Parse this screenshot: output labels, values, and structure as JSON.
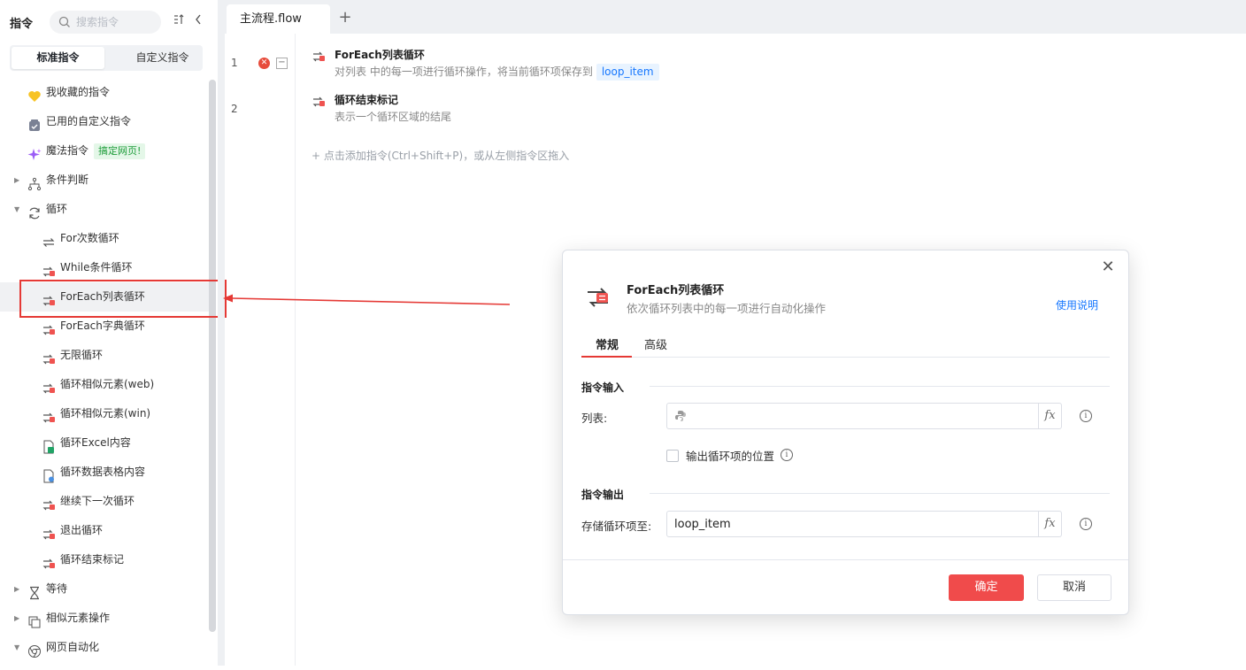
{
  "sidebar": {
    "title": "指令",
    "search_placeholder": "搜索指令",
    "tabs": [
      "标准指令",
      "自定义指令"
    ],
    "items": [
      {
        "label": "我收藏的指令",
        "icon": "heart-icon"
      },
      {
        "label": "已用的自定义指令",
        "icon": "custom-command-icon"
      },
      {
        "label": "魔法指令",
        "icon": "sparkle-icon",
        "badge": "搞定网页!"
      },
      {
        "label": "条件判断",
        "icon": "branch-icon"
      },
      {
        "label": "循环",
        "icon": "refresh-icon"
      },
      {
        "label": "For次数循环",
        "icon": "loop-icon"
      },
      {
        "label": "While条件循环",
        "icon": "loop-list-icon"
      },
      {
        "label": "ForEach列表循环",
        "icon": "loop-list-icon"
      },
      {
        "label": "ForEach字典循环",
        "icon": "loop-list-icon"
      },
      {
        "label": "无限循环",
        "icon": "loop-list-icon"
      },
      {
        "label": "循环相似元素(web)",
        "icon": "loop-list-icon"
      },
      {
        "label": "循环相似元素(win)",
        "icon": "loop-list-icon"
      },
      {
        "label": "循环Excel内容",
        "icon": "excel-file-icon"
      },
      {
        "label": "循环数据表格内容",
        "icon": "table-file-icon"
      },
      {
        "label": "继续下一次循环",
        "icon": "loop-list-icon"
      },
      {
        "label": "退出循环",
        "icon": "loop-list-icon"
      },
      {
        "label": "循环结束标记",
        "icon": "loop-list-icon"
      },
      {
        "label": "等待",
        "icon": "hourglass-icon"
      },
      {
        "label": "相似元素操作",
        "icon": "copy-icon"
      },
      {
        "label": "网页自动化",
        "icon": "browser-icon"
      }
    ]
  },
  "editor": {
    "tab_label": "主流程.flow",
    "steps": [
      {
        "line": "1",
        "title": "ForEach列表循环",
        "desc": "对列表 中的每一项进行循环操作，将当前循环项保存到",
        "var": "loop_item"
      },
      {
        "line": "2",
        "title": "循环结束标记",
        "desc": "表示一个循环区域的结尾"
      }
    ],
    "add_hint": "+ 点击添加指令(Ctrl+Shift+P)，或从左侧指令区拖入"
  },
  "dialog": {
    "title": "ForEach列表循环",
    "subtitle": "依次循环列表中的每一项进行自动化操作",
    "help_link": "使用说明",
    "tabs": [
      "常规",
      "高级"
    ],
    "input_section": "指令输入",
    "list_label": "列表:",
    "list_value": "",
    "checkbox_label": "输出循环项的位置",
    "output_section": "指令输出",
    "store_label": "存储循环项至:",
    "store_value": "loop_item",
    "fx_label": "fx",
    "ok": "确定",
    "cancel": "取消"
  },
  "colors": {
    "accent": "#f04b4b",
    "link": "#1677ff",
    "highlight_box": "#e53935"
  }
}
